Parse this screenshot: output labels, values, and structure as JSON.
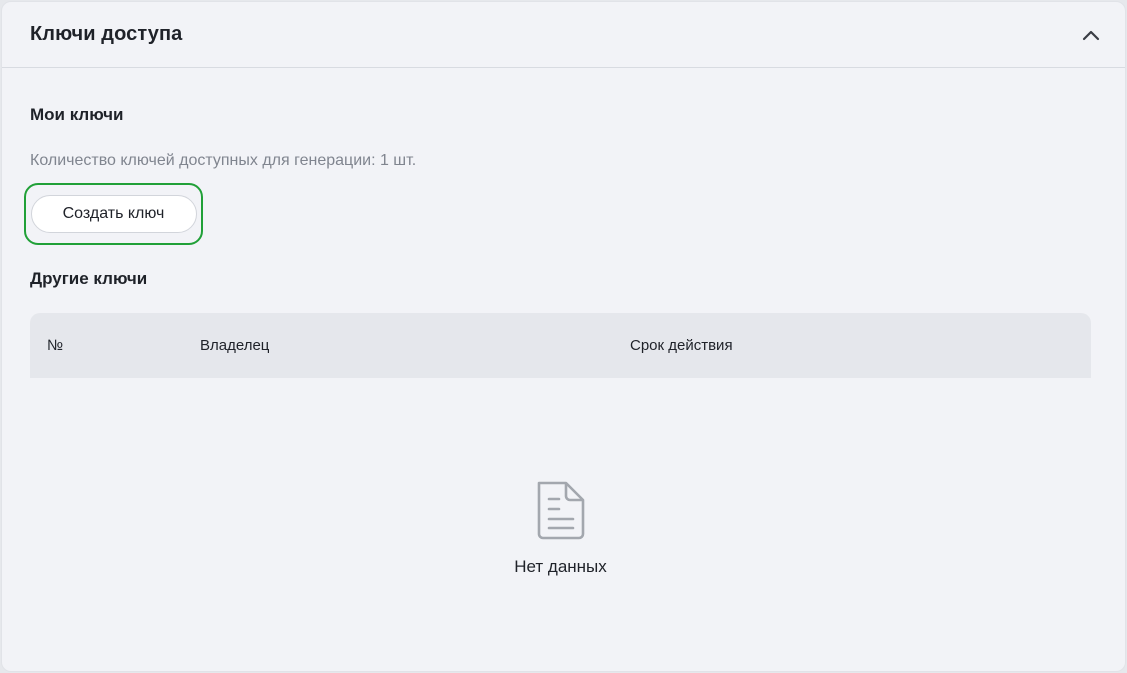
{
  "panel": {
    "title": "Ключи доступа",
    "collapse_icon": "chevron-up-icon"
  },
  "my_keys": {
    "title": "Мои ключи",
    "quota_text": "Количество ключей доступных для генерации: 1 шт.",
    "create_button_label": "Создать ключ"
  },
  "other_keys": {
    "title": "Другие ключи",
    "columns": [
      "№",
      "Владелец",
      "Срок действия"
    ],
    "rows": [],
    "empty_icon": "document-icon",
    "empty_text": "Нет данных"
  },
  "colors": {
    "accent_green": "#21a038",
    "background": "#f2f3f7",
    "table_header": "#e5e7ec"
  }
}
